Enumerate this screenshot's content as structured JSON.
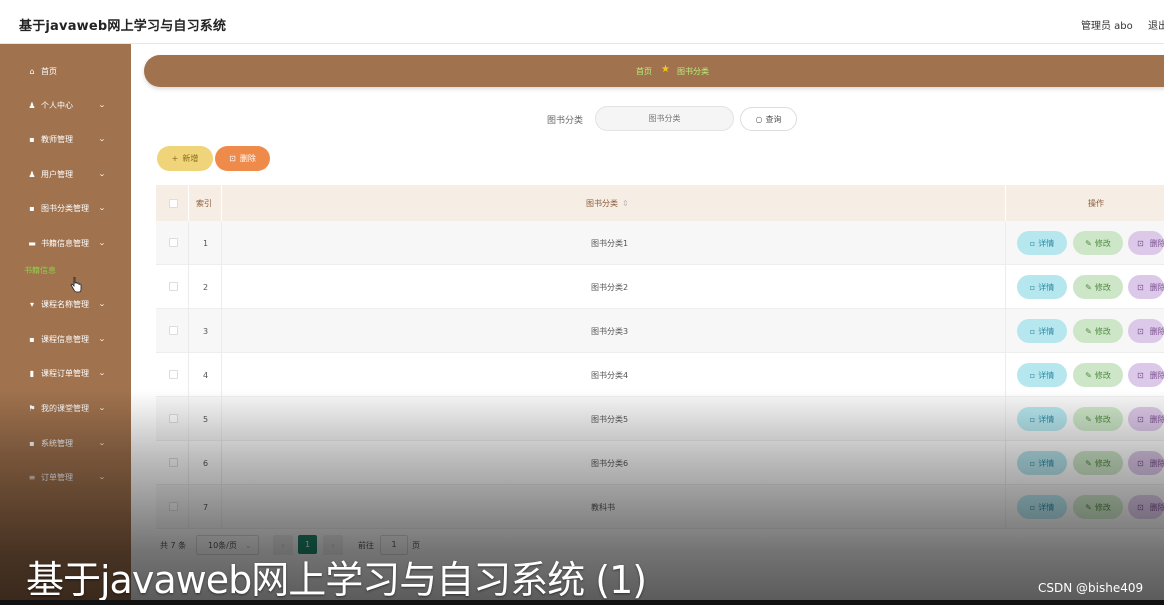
{
  "header": {
    "app_title": "基于javaweb网上学习与自习系统",
    "user_info": "管理员 abo",
    "logout": "退出"
  },
  "sidebar": {
    "items": [
      {
        "icon": "home-icon",
        "glyph": "⌂",
        "label": "首页",
        "chevron": false
      },
      {
        "icon": "user-icon",
        "glyph": "♟",
        "label": "个人中心",
        "chevron": true
      },
      {
        "icon": "grid-icon",
        "glyph": "▪",
        "label": "教师管理",
        "chevron": true
      },
      {
        "icon": "user-icon",
        "glyph": "♟",
        "label": "用户管理",
        "chevron": true
      },
      {
        "icon": "grid-icon",
        "glyph": "▪",
        "label": "图书分类管理",
        "chevron": true
      },
      {
        "icon": "book-icon",
        "glyph": "▬",
        "label": "书籍信息管理",
        "chevron": true
      },
      {
        "icon": "chat-icon",
        "glyph": "▾",
        "label": "课程名称管理",
        "chevron": true
      },
      {
        "icon": "grid-icon",
        "glyph": "▪",
        "label": "课程信息管理",
        "chevron": true
      },
      {
        "icon": "document-icon",
        "glyph": "▮",
        "label": "课程订单管理",
        "chevron": true
      },
      {
        "icon": "flag-icon",
        "glyph": "⚑",
        "label": "我的课堂管理",
        "chevron": true
      },
      {
        "icon": "grid-icon",
        "glyph": "▪",
        "label": "系统管理",
        "chevron": true
      },
      {
        "icon": "list-icon",
        "glyph": "≡",
        "label": "订单管理",
        "chevron": true
      }
    ],
    "sub_item": "书籍信息"
  },
  "breadcrumb": {
    "home": "首页",
    "current": "图书分类"
  },
  "search": {
    "label": "图书分类",
    "placeholder": "图书分类",
    "button": "查询"
  },
  "toolbar": {
    "add": "新增",
    "delete": "删除"
  },
  "table": {
    "headers": {
      "index": "索引",
      "category": "图书分类",
      "actions": "操作"
    },
    "rows": [
      {
        "index": "1",
        "category": "图书分类1"
      },
      {
        "index": "2",
        "category": "图书分类2"
      },
      {
        "index": "3",
        "category": "图书分类3"
      },
      {
        "index": "4",
        "category": "图书分类4"
      },
      {
        "index": "5",
        "category": "图书分类5"
      },
      {
        "index": "6",
        "category": "图书分类6"
      },
      {
        "index": "7",
        "category": "教科书"
      }
    ],
    "actions": {
      "detail": "详情",
      "edit": "修改",
      "delete": "删除"
    }
  },
  "pagination": {
    "total": "共 7 条",
    "page_size": "10条/页",
    "current_page": "1",
    "goto_label": "前往",
    "goto_value": "1",
    "page_label": "页"
  },
  "overlay": {
    "caption": "基于javaweb网上学习与自习系统 (1)",
    "watermark": "CSDN @bishe409"
  },
  "colors": {
    "sidebar": "#a0724e",
    "breadcrumb_text": "#b9ef7a",
    "add_button": "#efd47a",
    "delete_button": "#ee8b4a",
    "detail_button": "#b6e6ee",
    "edit_button": "#cde6c8",
    "row_delete_button": "#dcc8e8",
    "pagination_active": "#1e8a6e"
  }
}
